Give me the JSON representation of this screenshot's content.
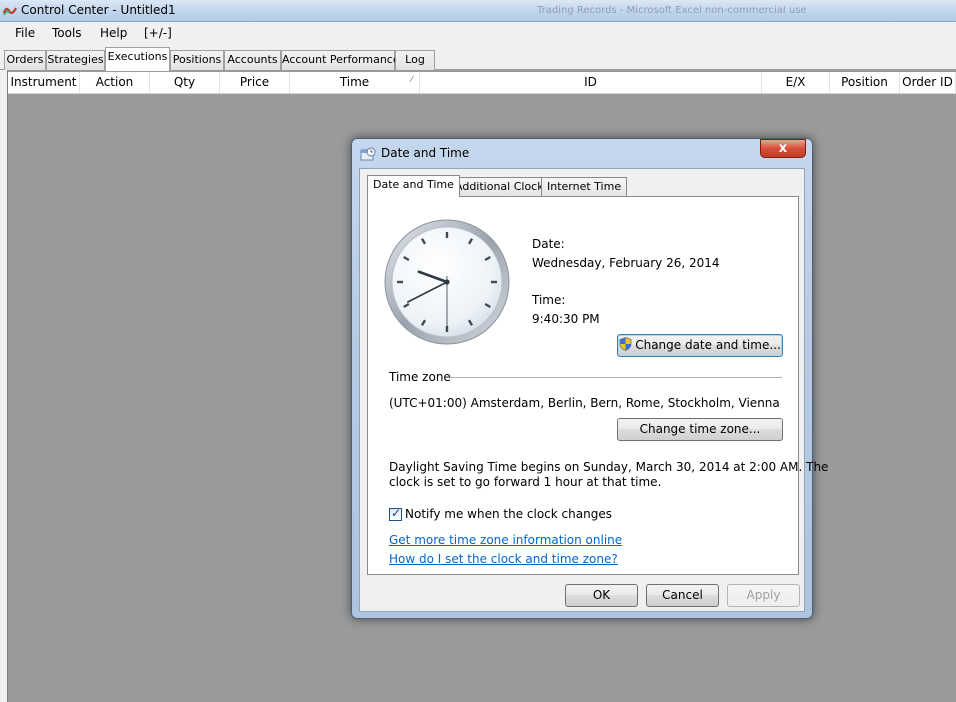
{
  "window": {
    "title": "Control Center - Untitled1",
    "ghost_title": "Trading Records - Microsoft Excel non-commercial use"
  },
  "menu": [
    "File",
    "Tools",
    "Help",
    "[+/-]"
  ],
  "tabs": [
    "Orders",
    "Strategies",
    "Executions",
    "Positions",
    "Accounts",
    "Account Performance",
    "Log"
  ],
  "active_tab": "Executions",
  "grid": {
    "columns": [
      "Instrument",
      "Action",
      "Qty",
      "Price",
      "Time",
      "ID",
      "E/X",
      "Position",
      "Order ID"
    ],
    "sort_column": "Time"
  },
  "dialog": {
    "title": "Date and Time",
    "close": "x",
    "tabs": [
      "Date and Time",
      "Additional Clocks",
      "Internet Time"
    ],
    "date_label": "Date:",
    "date_value": "Wednesday, February 26, 2014",
    "time_label": "Time:",
    "time_value": "9:40:30 PM",
    "change_datetime_button": "Change date and time...",
    "timezone_label": "Time zone",
    "timezone_value": "(UTC+01:00) Amsterdam, Berlin, Bern, Rome, Stockholm, Vienna",
    "change_timezone_button": "Change time zone...",
    "dst_line1": "Daylight Saving Time begins on Sunday, March 30, 2014 at 2:00 AM. The",
    "dst_line2": "clock is set to go forward 1 hour at that time.",
    "notify_label": "Notify me when the clock changes",
    "notify_checked": true,
    "link1": "Get more time zone information online",
    "link2": "How do I set the clock and time zone?",
    "ok": "OK",
    "cancel": "Cancel",
    "apply": "Apply"
  },
  "clock": {
    "hour": 9,
    "minute": 40,
    "second": 30
  },
  "colors": {
    "link": "#0066cc",
    "close_button": "#c43a25",
    "workspace": "#9a9a9a"
  }
}
